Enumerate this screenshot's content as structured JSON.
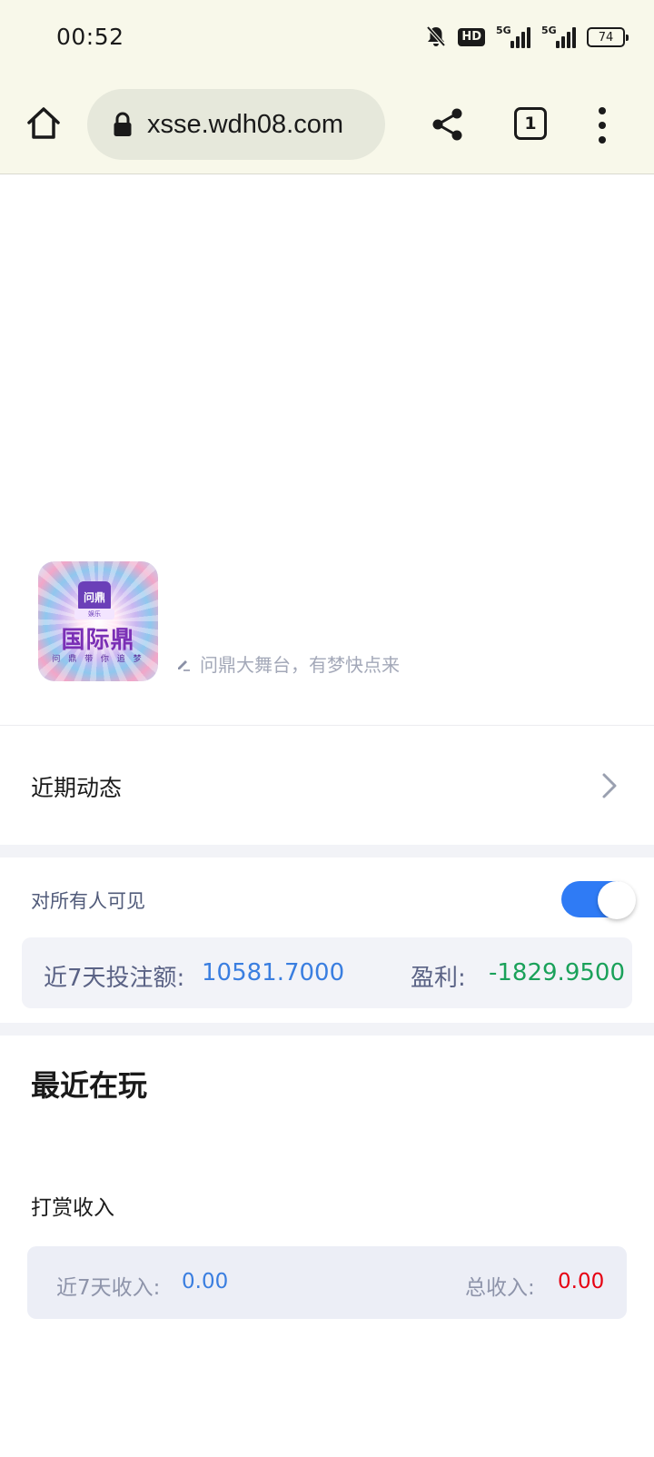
{
  "status_bar": {
    "time": "00:52",
    "hd_label": "HD",
    "signal_1_label": "5G",
    "signal_2_label": "5G",
    "battery": "74",
    "icons": [
      "bell-muted-icon",
      "hd-icon",
      "signal-5g-icon",
      "signal-5g-icon",
      "battery-icon"
    ]
  },
  "browser": {
    "url": "xsse.wdh08.com",
    "tab_count": "1",
    "icons": [
      "home-icon",
      "lock-icon",
      "share-icon",
      "tabs-icon",
      "more-vert-icon"
    ]
  },
  "profile": {
    "logo": {
      "badge_text": "问鼎",
      "sub_text": "娱乐",
      "name": "国际鼎",
      "slogan": "问 鼎 带 你 追 梦"
    },
    "motto": "问鼎大舞台，有梦快点来"
  },
  "recent_activity": {
    "label": "近期动态"
  },
  "visibility": {
    "label": "对所有人可见",
    "enabled": true
  },
  "stats": {
    "bet_label": "近7天投注额:",
    "bet_value": "10581.7000",
    "profit_label": "盈利:",
    "profit_value": "-1829.9500"
  },
  "recent_playing": {
    "title": "最近在玩"
  },
  "tips": {
    "title": "打赏收入",
    "week_label": "近7天收入:",
    "week_value": "0.00",
    "total_label": "总收入:",
    "total_value": "0.00"
  },
  "colors": {
    "browser_bg": "#f8f8ea",
    "accent_blue": "#3a7ee0",
    "toggle_blue": "#2f7bf5",
    "profit_green": "#1aa15a",
    "income_red": "#e60012"
  }
}
